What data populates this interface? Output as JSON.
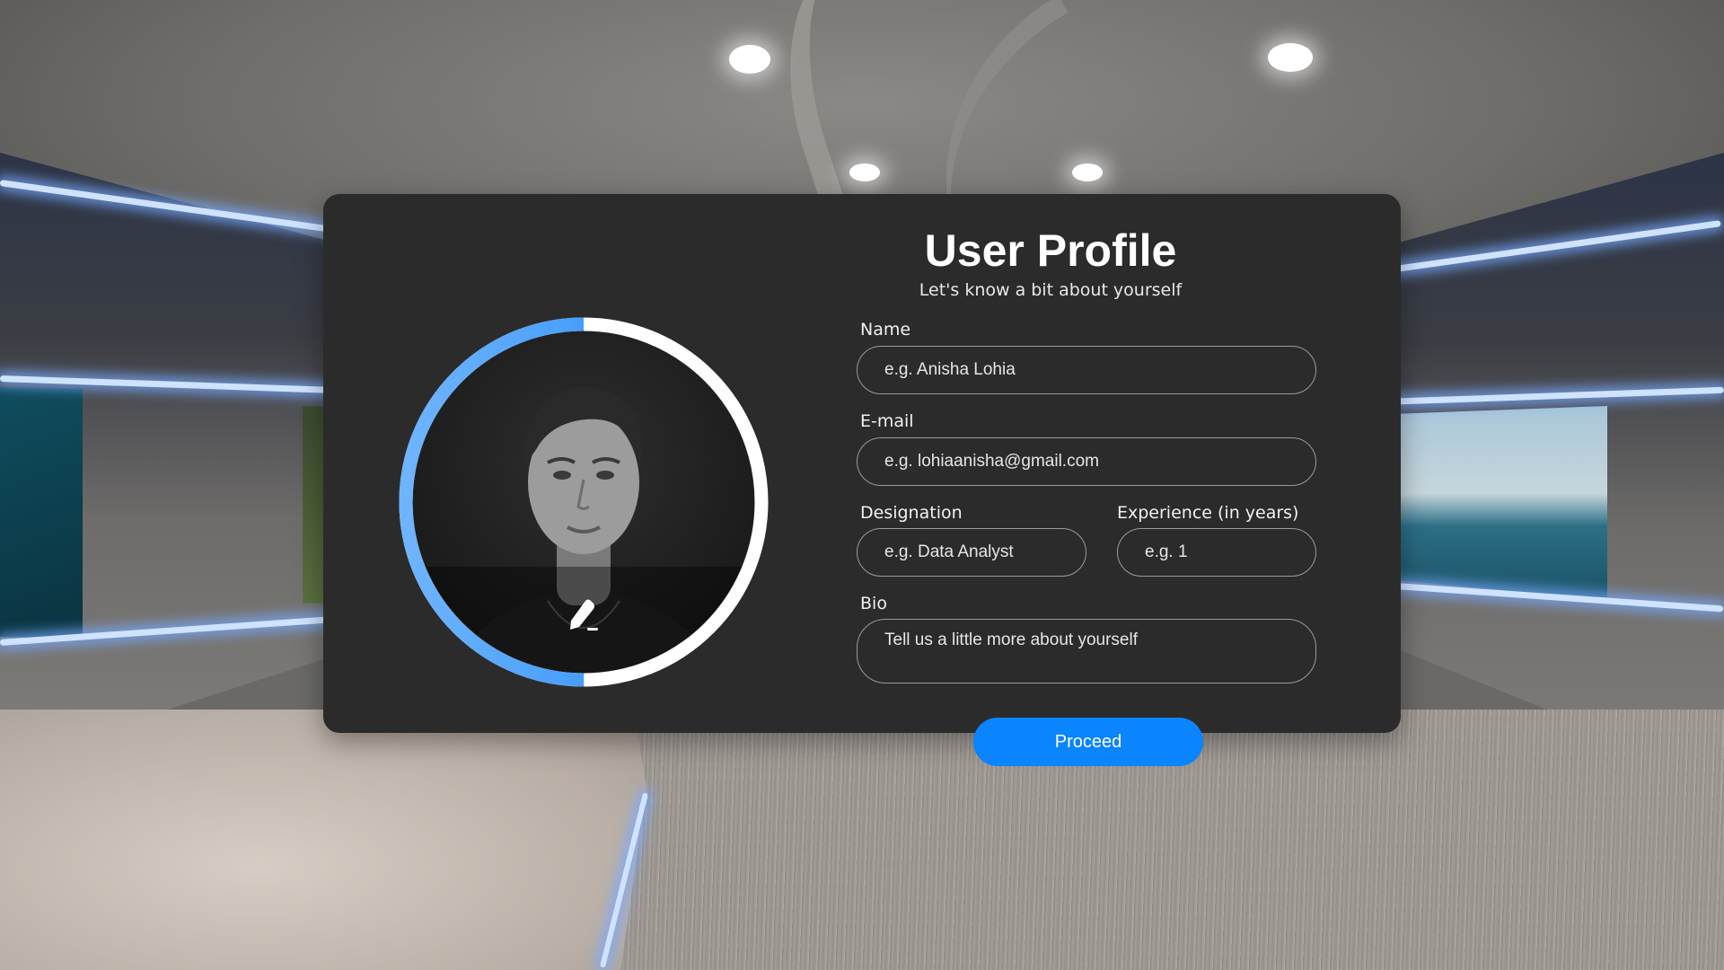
{
  "profile": {
    "title": "User Profile",
    "subtitle": "Let's know a bit about yourself",
    "avatar_progress": 0.5
  },
  "form": {
    "name": {
      "label": "Name",
      "placeholder": "e.g. Anisha Lohia"
    },
    "email": {
      "label": "E-mail",
      "placeholder": "e.g. lohiaanisha@gmail.com"
    },
    "designation": {
      "label": "Designation",
      "placeholder": "e.g. Data Analyst"
    },
    "experience": {
      "label": "Experience (in years)",
      "placeholder": "e.g. 1"
    },
    "bio": {
      "label": "Bio",
      "placeholder": "Tell us a little more about yourself"
    }
  },
  "actions": {
    "proceed_label": "Proceed"
  },
  "colors": {
    "accent": "#0a84ff",
    "panel": "#2b2b2b",
    "ring_progress": "#1e88f5",
    "ring_track": "#ffffff"
  },
  "icons": {
    "edit": "pencil-edit-icon"
  }
}
